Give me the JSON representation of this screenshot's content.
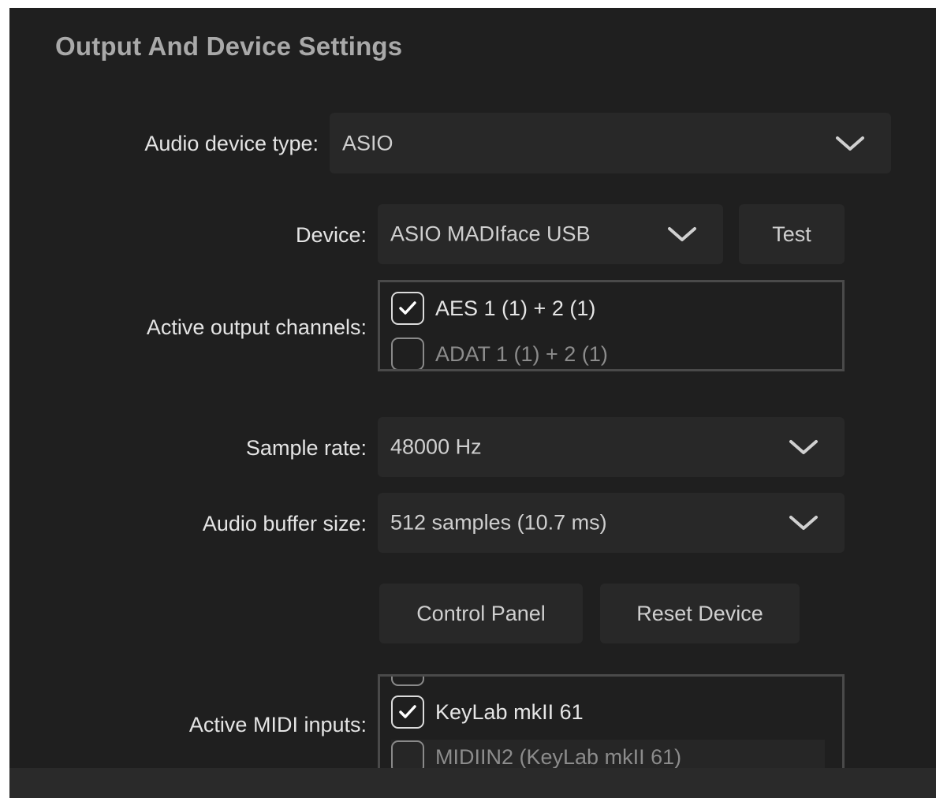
{
  "heading": "Output And Device Settings",
  "audio_device_type": {
    "label": "Audio device type:",
    "value": "ASIO"
  },
  "device": {
    "label": "Device:",
    "value": "ASIO MADIface USB",
    "test_label": "Test"
  },
  "active_output_channels": {
    "label": "Active output channels:",
    "items": [
      {
        "label": "AES 1 (1) + 2 (1)",
        "checked": true
      },
      {
        "label": "ADAT 1 (1) + 2 (1)",
        "checked": false
      }
    ]
  },
  "sample_rate": {
    "label": "Sample rate:",
    "value": "48000 Hz"
  },
  "buffer_size": {
    "label": "Audio buffer size:",
    "value": "512 samples (10.7 ms)"
  },
  "buttons": {
    "control_panel": "Control Panel",
    "reset_device": "Reset Device"
  },
  "active_midi_inputs": {
    "label": "Active MIDI inputs:",
    "items": [
      {
        "label": "KeyLab mkII 61",
        "checked": true
      },
      {
        "label": "MIDIIN2 (KeyLab mkII 61)",
        "checked": false
      }
    ]
  },
  "icons": {
    "dropdown": "chevron-down-icon",
    "check": "checkmark-icon"
  },
  "colors": {
    "background": "#1f1f1f",
    "control": "#282828",
    "border": "#4a4a4a",
    "text": "#e4e4e4"
  }
}
